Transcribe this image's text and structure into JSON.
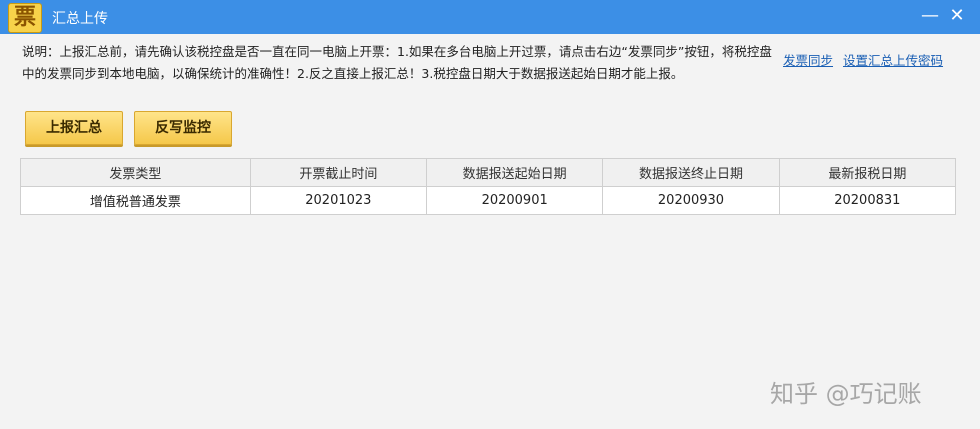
{
  "window": {
    "app_icon_glyph": "票",
    "title": "汇总上传",
    "minimize_glyph": "—",
    "close_glyph": "✕"
  },
  "description": "说明：上报汇总前，请先确认该税控盘是否一直在同一电脑上开票：1.如果在多台电脑上开过票，请点击右边“发票同步”按钮，将税控盘中的发票同步到本地电脑，以确保统计的准确性！2.反之直接上报汇总！3.税控盘日期大于数据报送起始日期才能上报。",
  "links": {
    "sync": "发票同步",
    "set_password": "设置汇总上传密码"
  },
  "buttons": {
    "report_summary": "上报汇总",
    "writeback_monitor": "反写监控"
  },
  "table": {
    "headers": [
      "发票类型",
      "开票截止时间",
      "数据报送起始日期",
      "数据报送终止日期",
      "最新报税日期"
    ],
    "rows": [
      [
        "增值税普通发票",
        "20201023",
        "20200901",
        "20200930",
        "20200831"
      ]
    ]
  },
  "watermark": "知乎 @巧记账",
  "colors": {
    "titlebar": "#3c8fe6",
    "button_fill": "#f5c84a",
    "link": "#1a5fb4"
  }
}
